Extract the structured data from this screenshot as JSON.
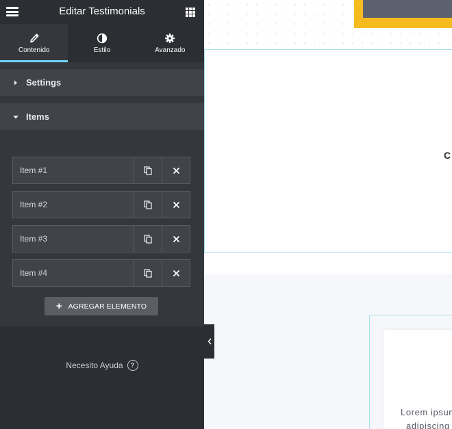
{
  "header": {
    "title": "Editar Testimonials",
    "menu_icon": "hamburger-icon",
    "apps_icon": "grid-icon"
  },
  "tabs": [
    {
      "label": "Contenido",
      "icon": "pencil-icon",
      "active": true
    },
    {
      "label": "Estilo",
      "icon": "contrast-icon",
      "active": false
    },
    {
      "label": "Avanzado",
      "icon": "gear-icon",
      "active": false
    }
  ],
  "sections": {
    "settings": {
      "label": "Settings",
      "expanded": false
    },
    "items": {
      "label": "Items",
      "expanded": true
    }
  },
  "items": [
    {
      "label": "Item #1"
    },
    {
      "label": "Item #2"
    },
    {
      "label": "Item #3"
    },
    {
      "label": "Item #4"
    }
  ],
  "add_button": {
    "label": "AGREGAR ELEMENTO"
  },
  "help": {
    "label": "Necesito Ayuda",
    "icon_glyph": "?"
  },
  "canvas": {
    "heading_fragment": "C",
    "lorem_line1": "Lorem ipsum",
    "lorem_line2": "adipiscing"
  },
  "colors": {
    "accent": "#71d7f7",
    "panel": "#34383c",
    "highlight": "#f6bb1e"
  }
}
